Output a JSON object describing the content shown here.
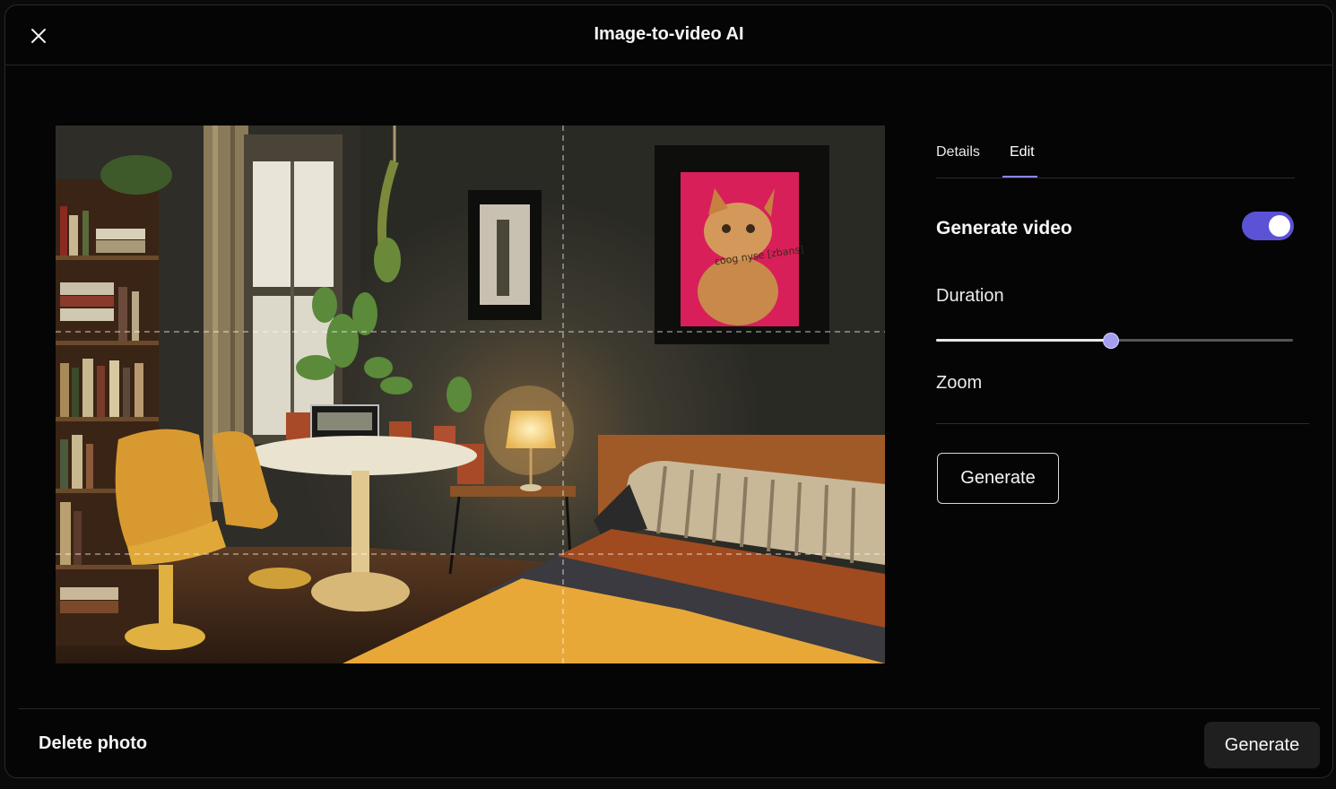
{
  "header": {
    "title": "Image-to-video AI",
    "close_icon": "close-icon"
  },
  "photo": {
    "description_icon": "bedroom-photo",
    "grid": "rule-of-thirds",
    "frame_text": "ɛoog nyse [zbans]"
  },
  "panel": {
    "tabs": [
      {
        "label": "Details",
        "active": false
      },
      {
        "label": "Edit",
        "active": true
      }
    ],
    "generate_video": {
      "label": "Generate video",
      "enabled": true
    },
    "duration": {
      "label": "Duration",
      "value_fraction": 0.49
    },
    "zoom": {
      "label": "Zoom"
    },
    "generate_button": "Generate"
  },
  "footer": {
    "delete_label": "Delete photo",
    "generate_label": "Generate"
  },
  "colors": {
    "accent": "#5b52d6",
    "tab_underline": "#8a85f5",
    "slider_thumb": "#a39ef0",
    "background": "#050505"
  }
}
